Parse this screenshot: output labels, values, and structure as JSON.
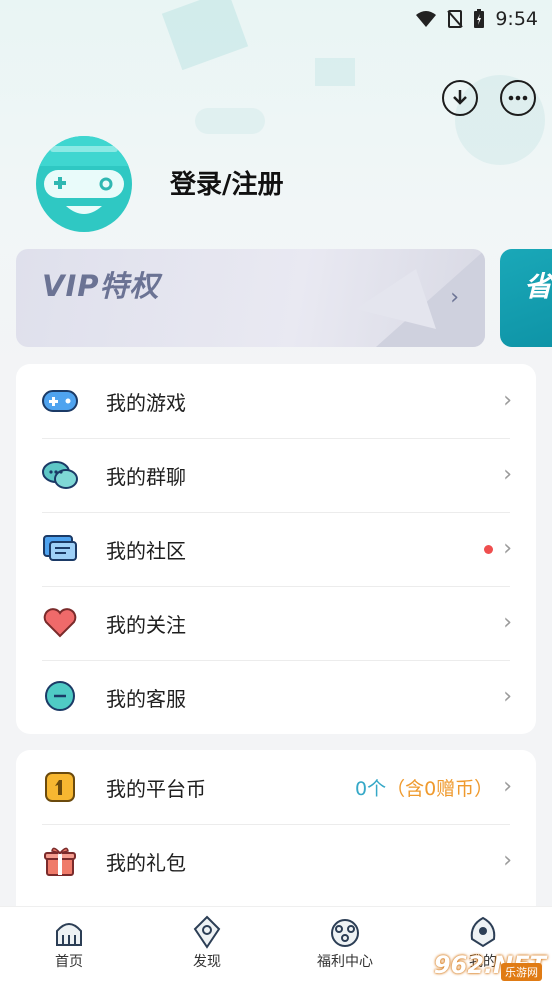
{
  "status_bar": {
    "time": "9:54"
  },
  "header": {
    "login_label": "登录/注册"
  },
  "vip": {
    "title": "VIP特权",
    "side_card_text": "省"
  },
  "menu_group_1": [
    {
      "label": "我的游戏",
      "icon": "gamepad-icon"
    },
    {
      "label": "我的群聊",
      "icon": "chat-bubbles-icon"
    },
    {
      "label": "我的社区",
      "icon": "community-icon",
      "has_dot": true
    },
    {
      "label": "我的关注",
      "icon": "heart-icon"
    },
    {
      "label": "我的客服",
      "icon": "support-icon"
    }
  ],
  "menu_group_2": [
    {
      "label": "我的平台币",
      "icon": "coin-icon",
      "value": "0个",
      "value_suffix": "（含0赠币）"
    },
    {
      "label": "我的礼包",
      "icon": "gift-icon"
    }
  ],
  "tabs": [
    {
      "label": "首页",
      "icon": "home-tab-icon"
    },
    {
      "label": "发现",
      "icon": "discover-tab-icon"
    },
    {
      "label": "福利中心",
      "icon": "welfare-tab-icon"
    },
    {
      "label": "我的",
      "icon": "me-tab-icon"
    }
  ],
  "watermark": {
    "main": "962.NET",
    "sub": "乐游网"
  },
  "colors": {
    "accent": "#2fc8c3",
    "vip_text": "#6b7394",
    "coin_text": "#35a8c7",
    "dot": "#ef4e4e"
  }
}
